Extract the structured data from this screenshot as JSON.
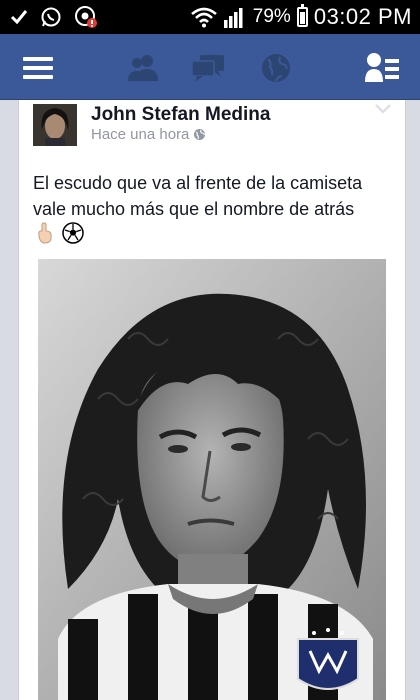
{
  "status_bar": {
    "battery": "79%",
    "time": "03:02 PM",
    "icons": [
      "check-icon",
      "whatsapp-icon",
      "chrome-notification-icon",
      "wifi-icon",
      "signal-icon",
      "battery-icon"
    ]
  },
  "nav": {
    "icons": [
      "menu-icon",
      "friend-requests-icon",
      "messages-icon",
      "notifications-globe-icon",
      "contacts-icon"
    ],
    "colors": {
      "bar": "#3b5998",
      "icon_inactive": "#2d4573",
      "icon_active": "#ffffff"
    }
  },
  "post": {
    "author": "John Stefan Medina",
    "time": "Hace una hora",
    "text": "El escudo que va al frente de la camiseta vale mucho más que el nombre de atrás",
    "emoji": [
      "hand-pointing-icon",
      "soccer-ball-icon"
    ]
  }
}
